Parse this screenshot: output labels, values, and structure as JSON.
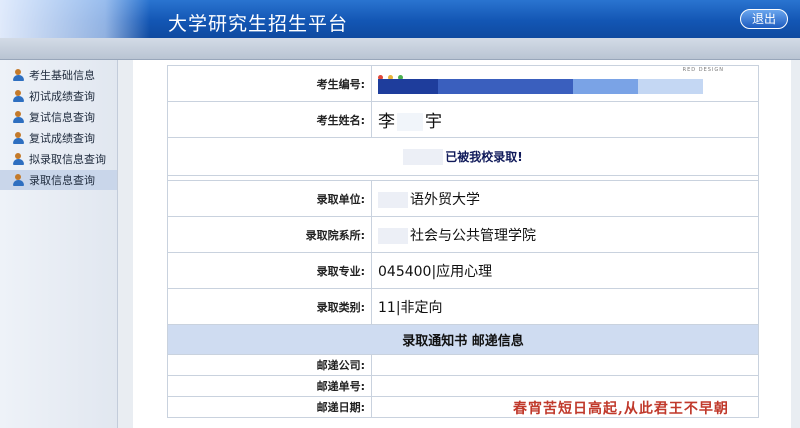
{
  "header": {
    "title": "大学研究生招生平台",
    "logout_label": "退出"
  },
  "sidebar": {
    "items": [
      {
        "label": "考生基础信息"
      },
      {
        "label": "初试成绩查询"
      },
      {
        "label": "复试信息查询"
      },
      {
        "label": "复试成绩查询"
      },
      {
        "label": "拟录取信息查询"
      },
      {
        "label": "录取信息查询"
      }
    ],
    "active_index": 5
  },
  "main": {
    "fields": {
      "exam_no_label": "考生编号:",
      "name_label": "考生姓名:",
      "name_first": "李",
      "name_last": "宇",
      "admit_message": "已被我校录取!",
      "unit_label": "录取单位:",
      "unit_value": "语外贸大学",
      "dept_label": "录取院系所:",
      "dept_value": "社会与公共管理学院",
      "major_label": "录取专业:",
      "major_value": "045400|应用心理",
      "type_label": "录取类别:",
      "type_value": "11|非定向"
    },
    "banner_text": "RED DESIGN",
    "section_title": "录取通知书 邮递信息",
    "mail": {
      "company_label": "邮递公司:",
      "tracking_label": "邮递单号:",
      "date_label": "邮递日期:"
    }
  },
  "overlay_text": "春宵苦短日高起,从此君王不早朝",
  "colors": {
    "header_blue": "#1356b4",
    "section_bg": "#cfdcf1",
    "overlay_red": "#c0392b"
  }
}
